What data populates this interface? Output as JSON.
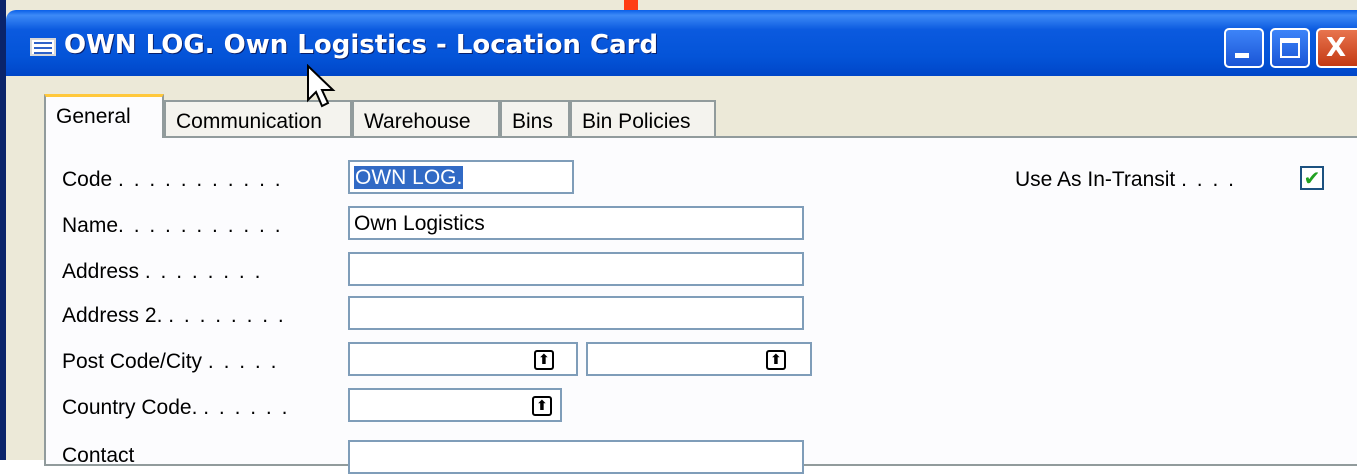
{
  "window": {
    "title": "OWN LOG. Own Logistics - Location Card",
    "title_icon": "table-icon",
    "buttons": [
      "minimize-icon",
      "maximize-icon",
      "close-icon"
    ],
    "close_glyph": "X"
  },
  "tabs": [
    {
      "label": "General",
      "active": true
    },
    {
      "label": "Communication",
      "active": false
    },
    {
      "label": "Warehouse",
      "active": false
    },
    {
      "label": "Bins",
      "active": false
    },
    {
      "label": "Bin Policies",
      "active": false
    }
  ],
  "form": {
    "code": {
      "label": "Code",
      "dots": ". . . . . . . . . . .",
      "value": "OWN LOG."
    },
    "name": {
      "label": "Name",
      "dots": ". . . . . . . . . . .",
      "value": "Own Logistics"
    },
    "address": {
      "label": "Address",
      "dots": ". . . . . . . .",
      "value": ""
    },
    "address2": {
      "label": "Address 2",
      "dots": ". . . . . . . .",
      "value": ""
    },
    "post_code_city": {
      "label": "Post Code/City",
      "dots": ". . . . .",
      "post_code": "",
      "city": ""
    },
    "country_code": {
      "label": "Country Code",
      "dots": ". . . . . .",
      "value": ""
    },
    "contact": {
      "label": "Contact",
      "value": ""
    },
    "use_as_in_transit": {
      "label": "Use As In-Transit",
      "dots": ". . . .",
      "checked": true,
      "check_glyph": "✔"
    }
  },
  "lookup_glyph": "⬆",
  "colors": {
    "titlebar": "#0454d8",
    "selection": "#316ac5",
    "tab_highlight": "#ffc83c",
    "check": "#21a121"
  }
}
